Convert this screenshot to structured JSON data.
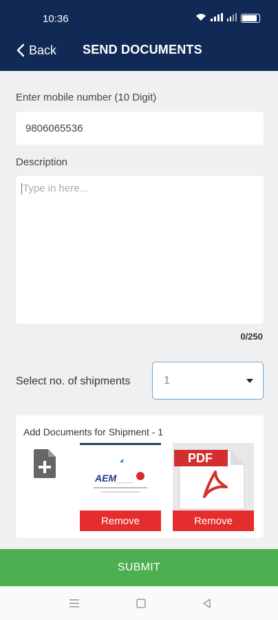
{
  "status_bar": {
    "time": "10:36"
  },
  "header": {
    "back_label": "Back",
    "title": "SEND DOCUMENTS"
  },
  "form": {
    "mobile_label": "Enter mobile number (10 Digit)",
    "mobile_value": "9806065536",
    "description_label": "Description",
    "description_placeholder": "Type in here...",
    "description_counter": "0/250",
    "shipments_label": "Select no. of shipments",
    "shipments_selected": "1"
  },
  "documents": {
    "card_title": "Add Documents for Shipment - 1",
    "items": [
      {
        "type": "image",
        "logo_text": "AEM",
        "remove_label": "Remove"
      },
      {
        "type": "pdf",
        "badge": "PDF",
        "remove_label": "Remove"
      }
    ]
  },
  "actions": {
    "submit_label": "SUBMIT"
  },
  "colors": {
    "header_bg": "#102a55",
    "submit_bg": "#4caf50",
    "remove_bg": "#e52d2d",
    "select_border": "#6aa7d4"
  },
  "icons": {
    "back": "chevron-left-icon",
    "add_document": "file-plus-icon",
    "dropdown": "caret-down-icon",
    "nav_menu": "menu-icon",
    "nav_home": "square-icon",
    "nav_back": "triangle-back-icon"
  }
}
